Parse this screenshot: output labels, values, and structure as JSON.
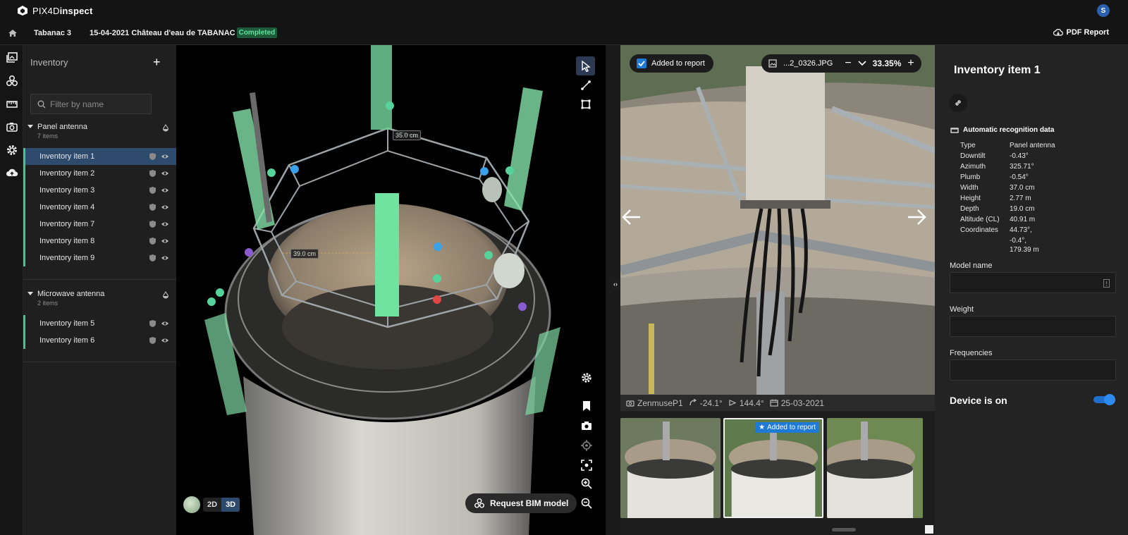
{
  "app": {
    "brand_prefix": "PIX4D",
    "brand_suffix": "inspect",
    "user_initial": "S"
  },
  "project": {
    "name": "Tabanac 3",
    "date_title": "15-04-2021 Château d'eau de TABANAC",
    "status": "Completed",
    "pdf_report": "PDF Report"
  },
  "inventory": {
    "title": "Inventory",
    "filter_placeholder": "Filter by name",
    "groups": [
      {
        "name": "Panel antenna",
        "count": "7 items",
        "items": [
          "Inventory item 1",
          "Inventory item 2",
          "Inventory item 3",
          "Inventory item 4",
          "Inventory item 7",
          "Inventory item 8",
          "Inventory item 9"
        ]
      },
      {
        "name": "Microwave antenna",
        "count": "2 items",
        "items": [
          "Inventory item 5",
          "Inventory item 6"
        ]
      }
    ],
    "selected": "Inventory item 1"
  },
  "view3d": {
    "measurements": [
      "35.0 cm",
      "39.0 cm"
    ],
    "mode_2d": "2D",
    "mode_3d": "3D",
    "active_mode": "3D",
    "bim_button": "Request BIM model"
  },
  "photo": {
    "added_to_report": "Added to report",
    "filename": "...2_0326.JPG",
    "zoom": "33.35%",
    "camera": "ZenmuseP1",
    "yaw": "-24.1°",
    "pitch": "144.4°",
    "date": "25-03-2021",
    "thumb_badge": "Added to report"
  },
  "details": {
    "title": "Inventory item 1",
    "auto_heading": "Automatic recognition data",
    "recognition": [
      {
        "k": "Type",
        "v": "Panel antenna"
      },
      {
        "k": "Downtilt",
        "v": "-0.43°"
      },
      {
        "k": "Azimuth",
        "v": "325.71°"
      },
      {
        "k": "Plumb",
        "v": "-0.54°"
      },
      {
        "k": "Width",
        "v": "37.0 cm"
      },
      {
        "k": "Height",
        "v": "2.77 m"
      },
      {
        "k": "Depth",
        "v": "19.0 cm"
      },
      {
        "k": "Altitude (CL)",
        "v": "40.91 m"
      },
      {
        "k": "Coordinates",
        "v": "44.73°,"
      },
      {
        "k": "",
        "v": "-0.4°,"
      },
      {
        "k": "",
        "v": "179.39 m"
      }
    ],
    "model_name_label": "Model name",
    "weight_label": "Weight",
    "frequencies_label": "Frequencies",
    "device_on_label": "Device is on",
    "device_on": true
  },
  "colors": {
    "accent": "#1f7ad6",
    "item_marker": "#3ec98a",
    "selected_row": "#2e4a6d",
    "status_green": "#5fe39c"
  }
}
